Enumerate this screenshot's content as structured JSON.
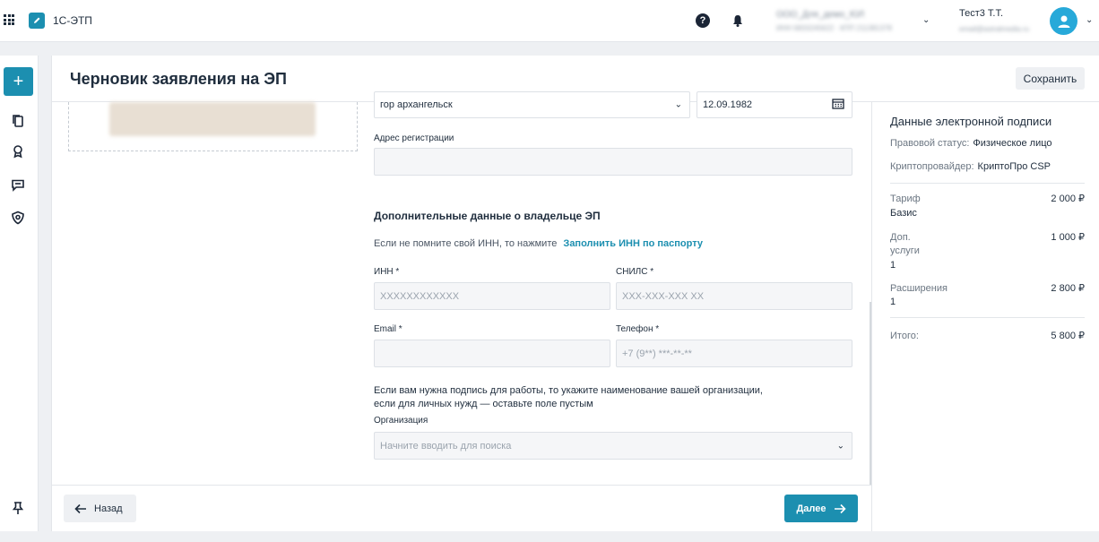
{
  "header": {
    "app_name": "1С-ЭТП",
    "help_glyph": "?",
    "org_name": "ООО_Для_демо_ЮЛ",
    "org_sub": "ИНН 6833245622 · КПП 211381378",
    "user_name": "Тест3 Т.Т.",
    "user_email": "email@astralmedia.ru"
  },
  "page": {
    "title": "Черновик заявления на ЭП",
    "save_label": "Сохранить"
  },
  "form": {
    "city_value": "гор архангельск",
    "birth_date": "12.09.1982",
    "address_label": "Адрес регистрации",
    "address_value": "",
    "extra_section_title": "Дополнительные данные о владельце ЭП",
    "inn_hint": "Если не помните свой ИНН, то нажмите",
    "inn_hint_link": "Заполнить ИНН по паспорту",
    "inn_label": "ИНН *",
    "inn_placeholder": "XXXXXXXXXXXX",
    "snils_label": "СНИЛС *",
    "snils_placeholder": "XXX-XXX-XXX XX",
    "email_label": "Email *",
    "email_value": "",
    "phone_label": "Телефон *",
    "phone_placeholder": "+7 (9**) ***-**-**",
    "org_hint_line1": "Если вам нужна подпись для работы, то укажите наименование вашей организации,",
    "org_hint_line2": "если для личных нужд — оставьте поле пустым",
    "org_label": "Организация",
    "org_placeholder": "Начните вводить для поиска"
  },
  "footer": {
    "back_label": "Назад",
    "next_label": "Далее"
  },
  "summary": {
    "title": "Данные электронной подписи",
    "legal_status_label": "Правовой статус:",
    "legal_status_value": "Физическое лицо",
    "crypto_label": "Криптопровайдер:",
    "crypto_value": "КриптоПро CSP",
    "tariff_label": "Тариф",
    "tariff_name": "Базис",
    "tariff_price": "2 000 ₽",
    "extra_label_1": "Доп.",
    "extra_label_2": "услуги",
    "extra_count": "1",
    "extra_price": "1 000 ₽",
    "ext_label": "Расширения",
    "ext_count": "1",
    "ext_price": "2 800 ₽",
    "total_label": "Итого:",
    "total_price": "5 800 ₽"
  },
  "colors": {
    "accent": "#1c8fb0",
    "avatar": "#27a9d9",
    "text": "#1f2d3d"
  },
  "icons": [
    "apps-grid-icon",
    "pen-icon",
    "help-icon",
    "bell-icon",
    "user-icon",
    "plus-icon",
    "documents-icon",
    "award-icon",
    "chat-icon",
    "shield-icon",
    "pin-icon",
    "calendar-icon",
    "arrow-left-icon",
    "arrow-right-icon",
    "chevron-down-icon"
  ]
}
